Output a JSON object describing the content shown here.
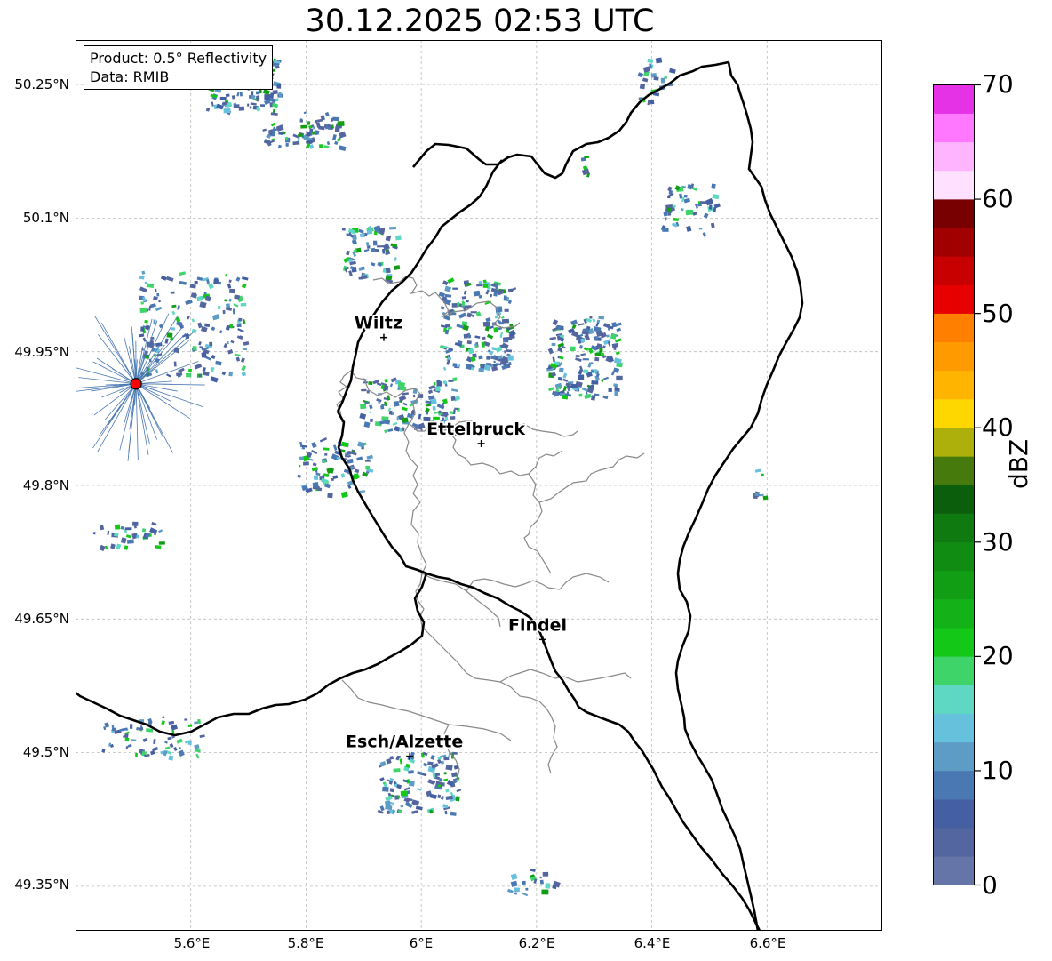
{
  "title": "30.12.2025 02:53 UTC",
  "info_box": {
    "product": "Product: 0.5° Reflectivity",
    "data": "Data: RMIB"
  },
  "y_tick_labels": [
    "50.25°N",
    "50.1°N",
    "49.95°N",
    "49.8°N",
    "49.65°N",
    "49.5°N",
    "49.35°N"
  ],
  "x_tick_labels": [
    "5.6°E",
    "5.8°E",
    "6°E",
    "6.2°E",
    "6.4°E",
    "6.6°E"
  ],
  "colorbar": {
    "label": "dBZ",
    "tick_labels": [
      "0",
      "10",
      "20",
      "30",
      "40",
      "50",
      "60",
      "70"
    ],
    "range": [
      0,
      70
    ],
    "step": 2.5,
    "colors": [
      "#6575a8",
      "#5466a0",
      "#445fa2",
      "#4a78b2",
      "#5d9cc5",
      "#66c1dc",
      "#5ed7c3",
      "#3fd46a",
      "#14c818",
      "#12b218",
      "#119e14",
      "#108c12",
      "#0f7a10",
      "#0b5e0c",
      "#467a0c",
      "#adb00a",
      "#ffd700",
      "#ffb500",
      "#ff9b00",
      "#ff7f00",
      "#e60000",
      "#c80000",
      "#a00000",
      "#780000",
      "#ffe0ff",
      "#ffb4ff",
      "#ff78ff",
      "#e632e6"
    ]
  },
  "cities": [
    {
      "name": "Wiltz",
      "lon": 5.935,
      "lat": 49.966
    },
    {
      "name": "Ettelbruck",
      "lon": 6.104,
      "lat": 49.847
    },
    {
      "name": "Findel",
      "lon": 6.211,
      "lat": 49.627
    },
    {
      "name": "Esch/Alzette",
      "lon": 5.98,
      "lat": 49.496
    }
  ],
  "radar_site": {
    "lon": 5.505,
    "lat": 49.914,
    "color": "#ff0000"
  },
  "map_extent": {
    "lon": [
      5.4,
      6.8
    ],
    "lat": [
      49.3,
      50.3
    ]
  }
}
